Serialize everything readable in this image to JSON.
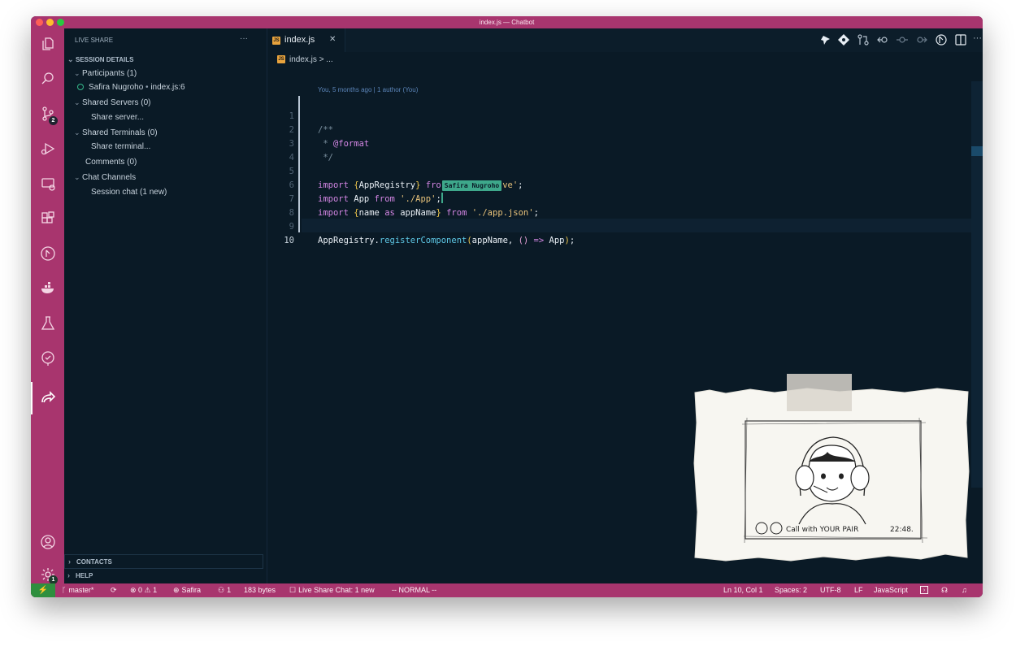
{
  "window": {
    "title": "index.js — Chatbot"
  },
  "activity_bar": {
    "icons": [
      "explorer-icon",
      "search-icon",
      "source-control-icon",
      "run-debug-icon",
      "remote-explorer-icon",
      "extensions-icon",
      "gitlens-icon",
      "docker-icon",
      "testing-icon",
      "gitlens-inspect-icon",
      "live-share-icon",
      "accounts-icon",
      "settings-gear-icon"
    ],
    "source_control_badge": "2",
    "settings_badge": "1"
  },
  "sidebar": {
    "header": "LIVE SHARE",
    "more": "···",
    "section": "SESSION DETAILS",
    "participants_label": "Participants (1)",
    "participant": "Safira Nugroho",
    "participant_location": "index.js:6",
    "shared_servers_label": "Shared Servers (0)",
    "share_server": "Share server...",
    "shared_terminals_label": "Shared Terminals (0)",
    "share_terminal": "Share terminal...",
    "comments_label": "Comments (0)",
    "chat_channels_label": "Chat Channels",
    "session_chat": "Session chat (1 new)",
    "contacts": "CONTACTS",
    "help": "HELP"
  },
  "editor": {
    "tab_label": "index.js",
    "tab_close": "✕",
    "tab_icon_text": "JS",
    "breadcrumb_file": "index.js",
    "breadcrumb_rest": "> ...",
    "blame": "You, 5 months ago | 1 author (You)",
    "line_numbers": [
      "1",
      "2",
      "3",
      "4",
      "5",
      "6",
      "7",
      "8",
      "9",
      "10"
    ],
    "cursor_label": "Safira Nugroho",
    "code": {
      "l1": "/**",
      "l2_a": " * ",
      "l2_b": "@format",
      "l3": " */",
      "l5_import": "import ",
      "l5_open": "{",
      "l5_id": "AppRegistry",
      "l5_close": "}",
      "l5_from": " fro",
      "l5_str": "ve'",
      "l5_semi": ";",
      "l6_import": "import ",
      "l6_id": "App",
      "l6_from": " from ",
      "l6_str": "'./App'",
      "l6_semi": ";",
      "l7_import": "import ",
      "l7_open": "{",
      "l7_id1": "name",
      "l7_as": " as ",
      "l7_id2": "appName",
      "l7_close": "}",
      "l7_from": " from ",
      "l7_str": "'./app.json'",
      "l7_semi": ";",
      "l9_obj": "AppRegistry",
      "l9_dot": ".",
      "l9_fn": "registerComponent",
      "l9_open": "(",
      "l9_arg": "appName, ",
      "l9_arrow_p": "()",
      "l9_arrow": " => ",
      "l9_app": "App",
      "l9_close": ")",
      "l9_semi": ";"
    },
    "toolbar_more": "···"
  },
  "status_bar": {
    "remote": "⚡",
    "branch": "master*",
    "sync": "⟳",
    "problems": "⊗ 0 ⚠ 1",
    "user": "Safira",
    "participants": "1",
    "bytes": "183 bytes",
    "chat": "Live Share Chat: 1 new",
    "mode": "-- NORMAL --",
    "position": "Ln 10, Col 1",
    "spaces": "Spaces: 2",
    "encoding": "UTF-8",
    "eol": "LF",
    "language": "JavaScript"
  },
  "sticker": {
    "caption": "Call with YOUR PAIR",
    "time": "22:48."
  },
  "colors": {
    "accent": "#a8356e",
    "background": "#0a1a26",
    "participant_label": "#35b98a"
  }
}
